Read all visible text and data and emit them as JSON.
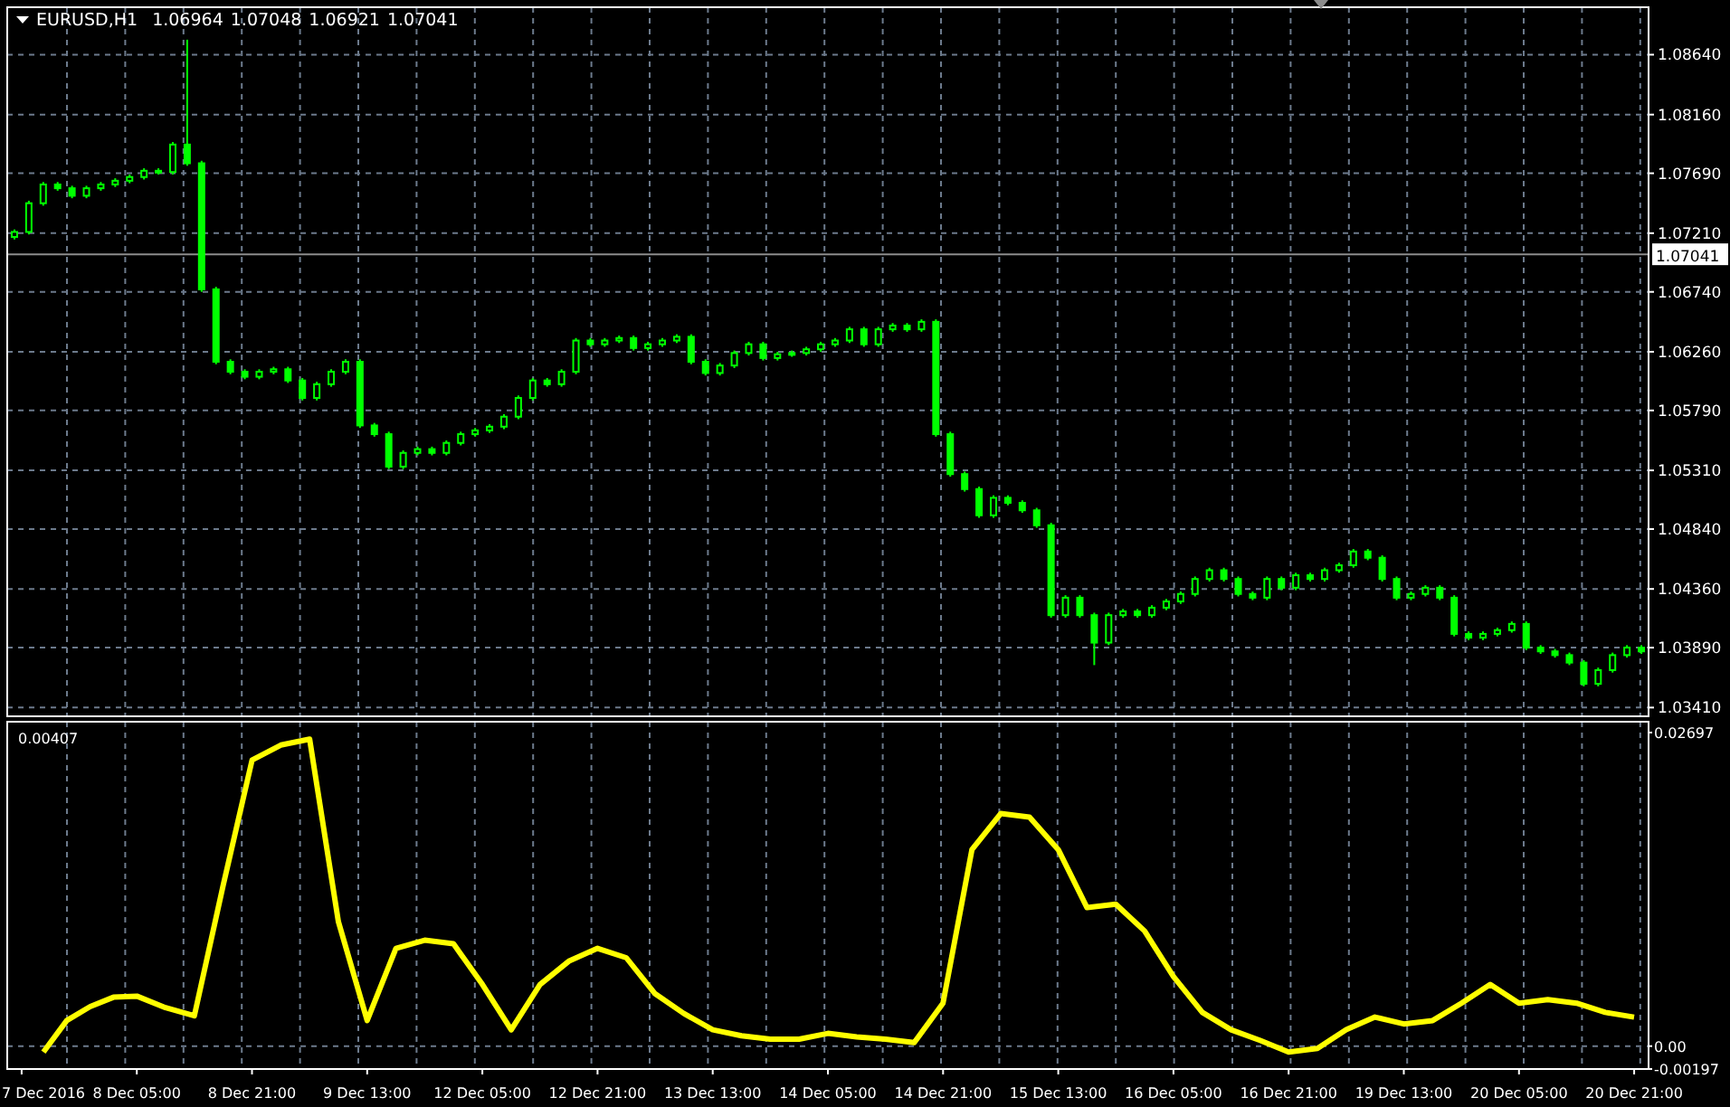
{
  "header": {
    "symbol": "EURUSD,H1",
    "values": [
      "1.06964",
      "1.07048",
      "1.06921",
      "1.07041"
    ]
  },
  "price_chart": {
    "chart_data": {
      "type": "candlestick",
      "grid": true,
      "ylim": [
        1.0334,
        1.0902
      ],
      "yticks": [
        {
          "value": 1.0864,
          "label": "1.08640"
        },
        {
          "value": 1.0816,
          "label": "1.08160"
        },
        {
          "value": 1.0769,
          "label": "1.07690"
        },
        {
          "value": 1.0721,
          "label": "1.07210"
        },
        {
          "value": 1.0674,
          "label": "1.06740"
        },
        {
          "value": 1.0626,
          "label": "1.06260"
        },
        {
          "value": 1.0579,
          "label": "1.05790"
        },
        {
          "value": 1.0531,
          "label": "1.05310"
        },
        {
          "value": 1.0484,
          "label": "1.04840"
        },
        {
          "value": 1.0436,
          "label": "1.04360"
        },
        {
          "value": 1.0389,
          "label": "1.03890"
        },
        {
          "value": 1.0341,
          "label": "1.03410"
        }
      ],
      "categories": [
        null,
        null,
        null,
        null,
        null,
        null,
        null,
        null,
        null,
        null,
        null,
        null,
        null,
        null,
        null,
        null,
        null,
        null,
        null,
        null,
        null,
        null,
        null,
        null,
        null,
        null,
        null,
        null,
        null,
        null,
        null,
        null,
        null,
        null,
        null,
        null,
        null,
        null,
        null,
        null,
        null,
        null,
        null,
        null,
        null,
        null,
        null,
        null,
        null,
        null,
        null,
        null,
        null,
        null,
        null,
        null,
        null,
        null,
        null,
        null,
        null,
        null,
        null,
        null,
        null,
        null,
        null,
        null,
        null,
        null,
        null,
        null,
        null,
        null,
        null,
        null,
        null,
        null,
        null,
        null,
        null,
        null,
        null,
        null,
        null,
        null,
        null,
        null,
        null,
        null,
        null,
        null,
        null,
        null,
        null,
        null,
        null,
        null,
        null,
        null,
        null,
        null,
        null,
        null,
        null,
        null,
        null,
        null,
        null,
        null,
        null,
        null,
        null,
        null
      ],
      "ohlc": [
        [
          1.0718,
          1.0724,
          1.0716,
          1.0722
        ],
        [
          1.0722,
          1.0747,
          1.072,
          1.0745
        ],
        [
          1.0745,
          1.0762,
          1.0743,
          1.076
        ],
        [
          1.076,
          1.0762,
          1.0755,
          1.0757
        ],
        [
          1.0757,
          1.0759,
          1.0749,
          1.0751
        ],
        [
          1.0751,
          1.0759,
          1.0749,
          1.0757
        ],
        [
          1.0757,
          1.0762,
          1.0755,
          1.076
        ],
        [
          1.076,
          1.0765,
          1.0758,
          1.0763
        ],
        [
          1.0763,
          1.0768,
          1.0761,
          1.0766
        ],
        [
          1.0766,
          1.0773,
          1.0764,
          1.0771
        ],
        [
          1.0771,
          1.0773,
          1.0768,
          1.077
        ],
        [
          1.077,
          1.0794,
          1.0768,
          1.0792
        ],
        [
          1.0792,
          1.0876,
          1.0775,
          1.0777
        ],
        [
          1.0777,
          1.0779,
          1.0674,
          1.0676
        ],
        [
          1.0676,
          1.0678,
          1.0616,
          1.0618
        ],
        [
          1.0618,
          1.062,
          1.0608,
          1.061
        ],
        [
          1.061,
          1.0612,
          1.0604,
          1.0606
        ],
        [
          1.0606,
          1.0612,
          1.0604,
          1.061
        ],
        [
          1.061,
          1.0614,
          1.0608,
          1.0612
        ],
        [
          1.0612,
          1.0614,
          1.0601,
          1.0603
        ],
        [
          1.0603,
          1.0605,
          1.0587,
          1.0589
        ],
        [
          1.0589,
          1.0602,
          1.0587,
          1.06
        ],
        [
          1.06,
          1.0612,
          1.0598,
          1.061
        ],
        [
          1.061,
          1.062,
          1.0608,
          1.0618
        ],
        [
          1.0618,
          1.062,
          1.0565,
          1.0567
        ],
        [
          1.0567,
          1.0569,
          1.0558,
          1.056
        ],
        [
          1.056,
          1.0562,
          1.0532,
          1.0534
        ],
        [
          1.0534,
          1.0547,
          1.0532,
          1.0545
        ],
        [
          1.0545,
          1.055,
          1.0543,
          1.0548
        ],
        [
          1.0548,
          1.055,
          1.0543,
          1.0545
        ],
        [
          1.0545,
          1.0555,
          1.0543,
          1.0553
        ],
        [
          1.0553,
          1.0562,
          1.0551,
          1.056
        ],
        [
          1.056,
          1.0565,
          1.0558,
          1.0563
        ],
        [
          1.0563,
          1.0568,
          1.0561,
          1.0566
        ],
        [
          1.0566,
          1.0576,
          1.0564,
          1.0574
        ],
        [
          1.0574,
          1.0591,
          1.0572,
          1.0589
        ],
        [
          1.0589,
          1.0605,
          1.0587,
          1.0603
        ],
        [
          1.0603,
          1.0605,
          1.0598,
          1.06
        ],
        [
          1.06,
          1.0612,
          1.0598,
          1.061
        ],
        [
          1.061,
          1.0637,
          1.0608,
          1.0635
        ],
        [
          1.0635,
          1.0637,
          1.063,
          1.0632
        ],
        [
          1.0632,
          1.0637,
          1.063,
          1.0635
        ],
        [
          1.0635,
          1.0639,
          1.0633,
          1.0637
        ],
        [
          1.0637,
          1.0639,
          1.0627,
          1.0629
        ],
        [
          1.0629,
          1.0634,
          1.0627,
          1.0632
        ],
        [
          1.0632,
          1.0637,
          1.063,
          1.0635
        ],
        [
          1.0635,
          1.064,
          1.0633,
          1.0638
        ],
        [
          1.0638,
          1.064,
          1.0616,
          1.0618
        ],
        [
          1.0618,
          1.062,
          1.0607,
          1.0609
        ],
        [
          1.0609,
          1.0617,
          1.0607,
          1.0615
        ],
        [
          1.0615,
          1.0627,
          1.0613,
          1.0625
        ],
        [
          1.0625,
          1.0634,
          1.0623,
          1.0632
        ],
        [
          1.0632,
          1.0634,
          1.0619,
          1.0621
        ],
        [
          1.0621,
          1.0626,
          1.0619,
          1.0624
        ],
        [
          1.0624,
          1.0627,
          1.0622,
          1.0625
        ],
        [
          1.0625,
          1.063,
          1.0623,
          1.0628
        ],
        [
          1.0628,
          1.0634,
          1.0626,
          1.0632
        ],
        [
          1.0632,
          1.0637,
          1.063,
          1.0635
        ],
        [
          1.0635,
          1.0646,
          1.0633,
          1.0644
        ],
        [
          1.0644,
          1.0646,
          1.063,
          1.0632
        ],
        [
          1.0632,
          1.0646,
          1.063,
          1.0644
        ],
        [
          1.0644,
          1.0649,
          1.0642,
          1.0647
        ],
        [
          1.0647,
          1.0649,
          1.0642,
          1.0644
        ],
        [
          1.0644,
          1.0652,
          1.0642,
          1.065
        ],
        [
          1.065,
          1.0652,
          1.0558,
          1.056
        ],
        [
          1.056,
          1.0562,
          1.0526,
          1.0528
        ],
        [
          1.0528,
          1.053,
          1.0514,
          1.0516
        ],
        [
          1.0516,
          1.0518,
          1.0493,
          1.0495
        ],
        [
          1.0495,
          1.0511,
          1.0493,
          1.0509
        ],
        [
          1.0509,
          1.0511,
          1.0503,
          1.0505
        ],
        [
          1.0505,
          1.0507,
          1.0497,
          1.0499
        ],
        [
          1.0499,
          1.0501,
          1.0485,
          1.0487
        ],
        [
          1.0487,
          1.0489,
          1.0413,
          1.0415
        ],
        [
          1.0415,
          1.0431,
          1.0413,
          1.0429
        ],
        [
          1.0429,
          1.0431,
          1.0413,
          1.0415
        ],
        [
          1.0415,
          1.0417,
          1.0375,
          1.0393
        ],
        [
          1.0393,
          1.0417,
          1.0391,
          1.0415
        ],
        [
          1.0415,
          1.042,
          1.0413,
          1.0418
        ],
        [
          1.0418,
          1.042,
          1.0413,
          1.0415
        ],
        [
          1.0415,
          1.0423,
          1.0413,
          1.0421
        ],
        [
          1.0421,
          1.0428,
          1.0419,
          1.0426
        ],
        [
          1.0426,
          1.0434,
          1.0424,
          1.0432
        ],
        [
          1.0432,
          1.0446,
          1.043,
          1.0444
        ],
        [
          1.0444,
          1.0453,
          1.0442,
          1.0451
        ],
        [
          1.0451,
          1.0453,
          1.0442,
          1.0444
        ],
        [
          1.0444,
          1.0446,
          1.043,
          1.0432
        ],
        [
          1.0432,
          1.0434,
          1.0427,
          1.0429
        ],
        [
          1.0429,
          1.0446,
          1.0427,
          1.0444
        ],
        [
          1.0444,
          1.0446,
          1.0435,
          1.0437
        ],
        [
          1.0437,
          1.0449,
          1.0435,
          1.0447
        ],
        [
          1.0447,
          1.0449,
          1.0442,
          1.0444
        ],
        [
          1.0444,
          1.0453,
          1.0442,
          1.0451
        ],
        [
          1.0451,
          1.0457,
          1.0449,
          1.0455
        ],
        [
          1.0455,
          1.0468,
          1.0453,
          1.0466
        ],
        [
          1.0466,
          1.0468,
          1.0459,
          1.0461
        ],
        [
          1.0461,
          1.0463,
          1.0442,
          1.0444
        ],
        [
          1.0444,
          1.0446,
          1.0427,
          1.0429
        ],
        [
          1.0429,
          1.0434,
          1.0427,
          1.0432
        ],
        [
          1.0432,
          1.0439,
          1.043,
          1.0437
        ],
        [
          1.0437,
          1.0439,
          1.0427,
          1.0429
        ],
        [
          1.0429,
          1.0431,
          1.0398,
          1.04
        ],
        [
          1.04,
          1.0402,
          1.0395,
          1.0397
        ],
        [
          1.0397,
          1.0402,
          1.0395,
          1.04
        ],
        [
          1.04,
          1.0405,
          1.0398,
          1.0403
        ],
        [
          1.0403,
          1.041,
          1.0401,
          1.0408
        ],
        [
          1.0408,
          1.041,
          1.0387,
          1.0389
        ],
        [
          1.0389,
          1.0391,
          1.0384,
          1.0386
        ],
        [
          1.0386,
          1.0388,
          1.0381,
          1.0383
        ],
        [
          1.0383,
          1.0385,
          1.0375,
          1.0377
        ],
        [
          1.0377,
          1.0379,
          1.0358,
          1.036
        ],
        [
          1.036,
          1.0373,
          1.0358,
          1.0371
        ],
        [
          1.0371,
          1.0385,
          1.0369,
          1.0383
        ],
        [
          1.0383,
          1.0391,
          1.0381,
          1.0389
        ],
        [
          1.0389,
          1.0391,
          1.0384,
          1.0386
        ]
      ],
      "ref_lines": [
        {
          "axis": "y",
          "value": 1.07041,
          "label": "1.07041"
        }
      ]
    }
  },
  "indicator": {
    "label": "0.00407",
    "chart_data": {
      "type": "line",
      "grid": true,
      "ylim": [
        -0.00197,
        0.0279
      ],
      "yticks": [
        {
          "value": 0.02697,
          "label": "0.02697"
        },
        {
          "value": 0,
          "label": "0.00"
        },
        {
          "value": -0.00197,
          "label": "-0.00197"
        }
      ],
      "categories": [
        "7 Dec 2016",
        null,
        null,
        null,
        "8 Dec 05:00",
        null,
        null,
        null,
        "8 Dec 21:00",
        null,
        null,
        null,
        "9 Dec 13:00",
        null,
        null,
        null,
        "12 Dec 05:00",
        null,
        null,
        null,
        "12 Dec 21:00",
        null,
        null,
        null,
        "13 Dec 13:00",
        null,
        null,
        null,
        "14 Dec 05:00",
        null,
        null,
        null,
        "14 Dec 21:00",
        null,
        null,
        null,
        "15 Dec 13:00",
        null,
        null,
        null,
        "16 Dec 05:00",
        null,
        null,
        null,
        "16 Dec 21:00",
        null,
        null,
        null,
        "19 Dec 13:00",
        null,
        null,
        null,
        "20 Dec 05:00",
        null,
        null,
        null,
        "20 Dec 21:00"
      ],
      "values": [
        -0.0005,
        0.0022,
        0.0034,
        0.0042,
        0.0043,
        0.0033,
        0.0026,
        0.0138,
        0.0246,
        0.0259,
        0.0264,
        0.0107,
        0.0022,
        0.0084,
        0.0091,
        0.0088,
        0.0053,
        0.0014,
        0.0053,
        0.0073,
        0.0084,
        0.0076,
        0.0045,
        0.0028,
        0.0014,
        0.0009,
        0.0006,
        0.0006,
        0.0011,
        0.0008,
        0.0006,
        0.0003,
        0.0037,
        0.0169,
        0.02,
        0.0197,
        0.0169,
        0.0119,
        0.0122,
        0.0099,
        0.006,
        0.0029,
        0.0014,
        0.0005,
        -0.0005,
        -0.0002,
        0.0014,
        0.0025,
        0.0019,
        0.0022,
        0.0037,
        0.0053,
        0.0037,
        0.004,
        0.0037,
        0.0029,
        0.0025
      ]
    }
  }
}
